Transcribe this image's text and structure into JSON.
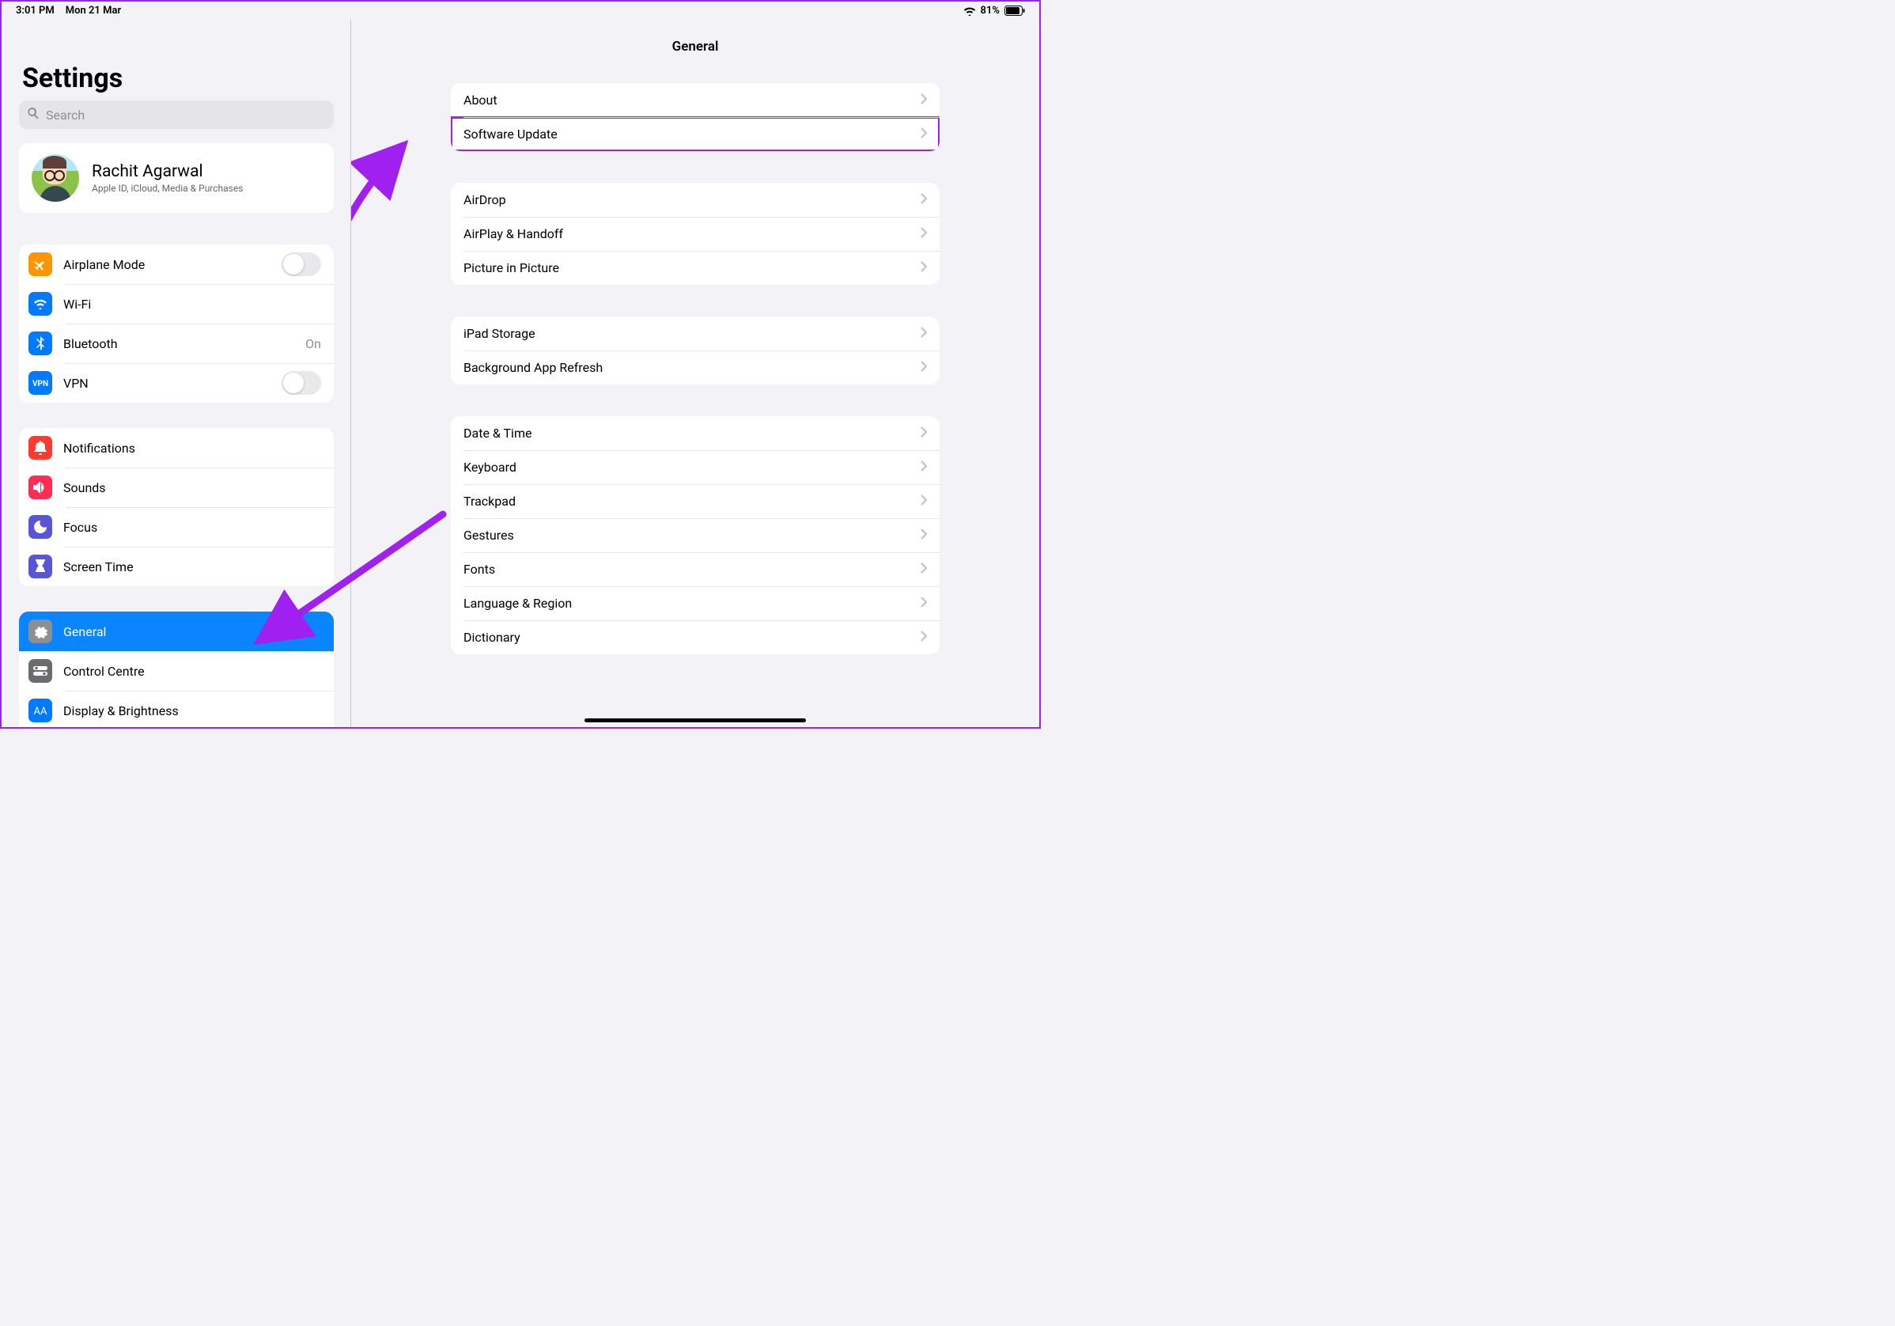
{
  "status": {
    "time": "3:01 PM",
    "date": "Mon 21 Mar",
    "battery_pct": "81%"
  },
  "sidebar": {
    "title": "Settings",
    "search_placeholder": "Search",
    "profile": {
      "name": "Rachit Agarwal",
      "sub": "Apple ID, iCloud, Media & Purchases"
    },
    "groups": [
      [
        {
          "label": "Airplane Mode",
          "icon": "airplane",
          "bg": "bg-orange",
          "control": "toggle"
        },
        {
          "label": "Wi-Fi",
          "icon": "wifi",
          "bg": "bg-blue",
          "value": ""
        },
        {
          "label": "Bluetooth",
          "icon": "bluetooth",
          "bg": "bg-blue",
          "value": "On"
        },
        {
          "label": "VPN",
          "icon": "vpn",
          "bg": "bg-blue",
          "control": "toggle"
        }
      ],
      [
        {
          "label": "Notifications",
          "icon": "bell",
          "bg": "bg-red"
        },
        {
          "label": "Sounds",
          "icon": "speaker",
          "bg": "bg-pink"
        },
        {
          "label": "Focus",
          "icon": "moon",
          "bg": "bg-indigo"
        },
        {
          "label": "Screen Time",
          "icon": "hourglass",
          "bg": "bg-indigo"
        }
      ],
      [
        {
          "label": "General",
          "icon": "gear",
          "bg": "bg-gray",
          "selected": true
        },
        {
          "label": "Control Centre",
          "icon": "switches",
          "bg": "bg-gray-dark"
        },
        {
          "label": "Display & Brightness",
          "icon": "aa",
          "bg": "bg-blue-brand"
        }
      ]
    ]
  },
  "main": {
    "title": "General",
    "groups": [
      [
        {
          "label": "About"
        },
        {
          "label": "Software Update",
          "highlighted": true
        }
      ],
      [
        {
          "label": "AirDrop"
        },
        {
          "label": "AirPlay & Handoff"
        },
        {
          "label": "Picture in Picture"
        }
      ],
      [
        {
          "label": "iPad Storage"
        },
        {
          "label": "Background App Refresh"
        }
      ],
      [
        {
          "label": "Date & Time"
        },
        {
          "label": "Keyboard"
        },
        {
          "label": "Trackpad"
        },
        {
          "label": "Gestures"
        },
        {
          "label": "Fonts"
        },
        {
          "label": "Language & Region"
        },
        {
          "label": "Dictionary"
        }
      ]
    ]
  }
}
